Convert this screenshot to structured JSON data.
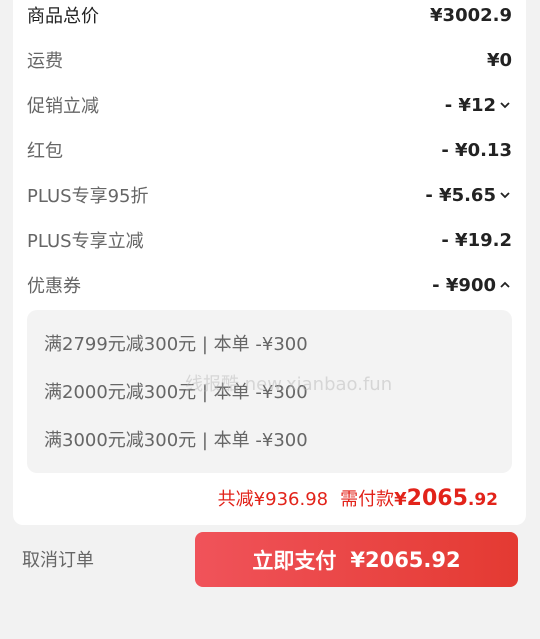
{
  "order": {
    "rows": [
      {
        "label": "商品总价",
        "value": "¥3002.9",
        "chevron": ""
      },
      {
        "label": "运费",
        "value": "¥0",
        "chevron": ""
      },
      {
        "label": "促销立减",
        "value": "- ¥12",
        "chevron": "down"
      },
      {
        "label": "红包",
        "value": "- ¥0.13",
        "chevron": ""
      },
      {
        "label": "PLUS专享95折",
        "value": "- ¥5.65",
        "chevron": "down"
      },
      {
        "label": "PLUS专享立减",
        "value": "- ¥19.2",
        "chevron": ""
      },
      {
        "label": "优惠券",
        "value": "- ¥900",
        "chevron": "up"
      }
    ],
    "coupons": [
      "满2799元减300元 | 本单 -¥300",
      "满2000元减300元 | 本单 -¥300",
      "满3000元减300元 | 本单 -¥300"
    ],
    "summary": {
      "discount_label": "共减",
      "discount_value": "¥936.98",
      "pay_label": "需付款",
      "currency": "¥",
      "pay_integer": "2065",
      "pay_decimal": ".92"
    },
    "watermark": "线报酷 new.xianbao.fun"
  },
  "footer": {
    "cancel_label": "取消订单",
    "pay_button_label": "立即支付",
    "pay_button_amount": "¥2065.92"
  },
  "colors": {
    "accent": "#e2231a",
    "button_start": "#f0535a",
    "button_end": "#e43a32"
  }
}
